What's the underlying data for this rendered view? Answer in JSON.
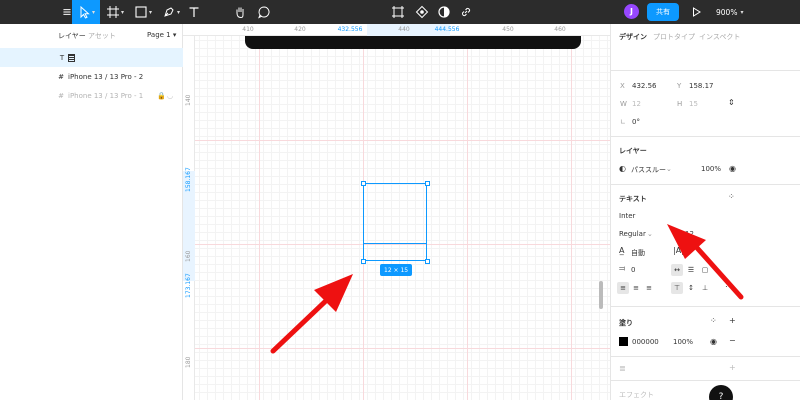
{
  "toolbar": {
    "avatar_initial": "J",
    "share_label": "共有",
    "zoom_label": "900%",
    "accent": "#0d99ff",
    "icons": [
      "menu-icon",
      "move-tool-icon",
      "frame-tool-icon",
      "rectangle-tool-icon",
      "pen-tool-icon",
      "text-tool-icon",
      "hand-tool-icon",
      "comment-icon",
      "component-icon",
      "boolean-icon",
      "contrast-icon",
      "link-icon",
      "play-icon"
    ]
  },
  "layers_panel": {
    "tab_layers": "レイヤー",
    "tab_assets": "アセット",
    "page_label": "Page 1",
    "rows": [
      {
        "label": ""
      },
      {
        "label": "iPhone 13 / 13 Pro - 2"
      },
      {
        "label": "iPhone 13 / 13 Pro - 1"
      }
    ]
  },
  "canvas": {
    "ruler_top": [
      "410",
      "420",
      "432.556",
      "440",
      "444.556",
      "450",
      "460",
      "470",
      "480",
      "490"
    ],
    "ruler_left": [
      "140",
      "158.167",
      "160",
      "173.167",
      "180"
    ],
    "selection_size": "12 × 15"
  },
  "design_panel": {
    "tabs": [
      "デザイン",
      "プロトタイプ",
      "インスペクト"
    ],
    "x_label": "X",
    "x_value": "432.56",
    "y_label": "Y",
    "y_value": "158.17",
    "w_label": "W",
    "w_value": "12",
    "h_label": "H",
    "h_value": "15",
    "rotation": "0°",
    "layer_section": "レイヤー",
    "blend_mode": "パススルー",
    "layer_opacity": "100%",
    "text_section": "テキスト",
    "font_family": "Inter",
    "font_weight": "Regular",
    "font_size": "12",
    "line_height": "自動",
    "letter_spacing": "0",
    "fill_section": "塗り",
    "fill_hex": "000000",
    "fill_opacity": "100%",
    "fill_color": "#000000",
    "effects_section": "エフェクト",
    "help_label": "?"
  }
}
